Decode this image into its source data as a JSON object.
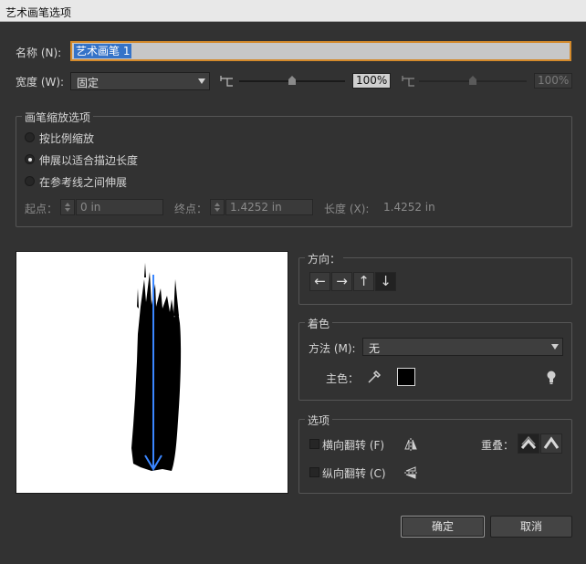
{
  "window": {
    "title": "艺术画笔选项"
  },
  "name": {
    "label": "名称 (N):",
    "value": "艺术画笔 1"
  },
  "width": {
    "label": "宽度 (W):",
    "mode": "固定",
    "percent_left": "100%",
    "percent_right": "100%"
  },
  "scale_options": {
    "title": "画笔缩放选项",
    "options": [
      {
        "label": "按比例缩放",
        "checked": false
      },
      {
        "label": "伸展以适合描边长度",
        "checked": true
      },
      {
        "label": "在参考线之间伸展",
        "checked": false
      }
    ],
    "start_label": "起点：",
    "start_value": "0 in",
    "end_label": "终点：",
    "end_value": "1.4252 in",
    "length_label": "长度 (X):",
    "length_value": "1.4252 in"
  },
  "direction": {
    "title": "方向：",
    "buttons": [
      "←",
      "→",
      "↑",
      "↓"
    ],
    "selected": "↓"
  },
  "colorization": {
    "title": "着色",
    "method_label": "方法 (M):",
    "method_value": "无",
    "key_color_label": "主色：",
    "key_color": "#000000"
  },
  "options": {
    "title": "选项",
    "flip_along_label": "横向翻转 (F)",
    "flip_across_label": "纵向翻转 (C)",
    "overlap_label": "重叠："
  },
  "buttons": {
    "ok": "确定",
    "cancel": "取消"
  },
  "colors": {
    "dialog_bg": "#323232",
    "selection": "#3573c8",
    "focus_ring": "#d48a2b",
    "arrow_blue": "#3a86ff"
  }
}
